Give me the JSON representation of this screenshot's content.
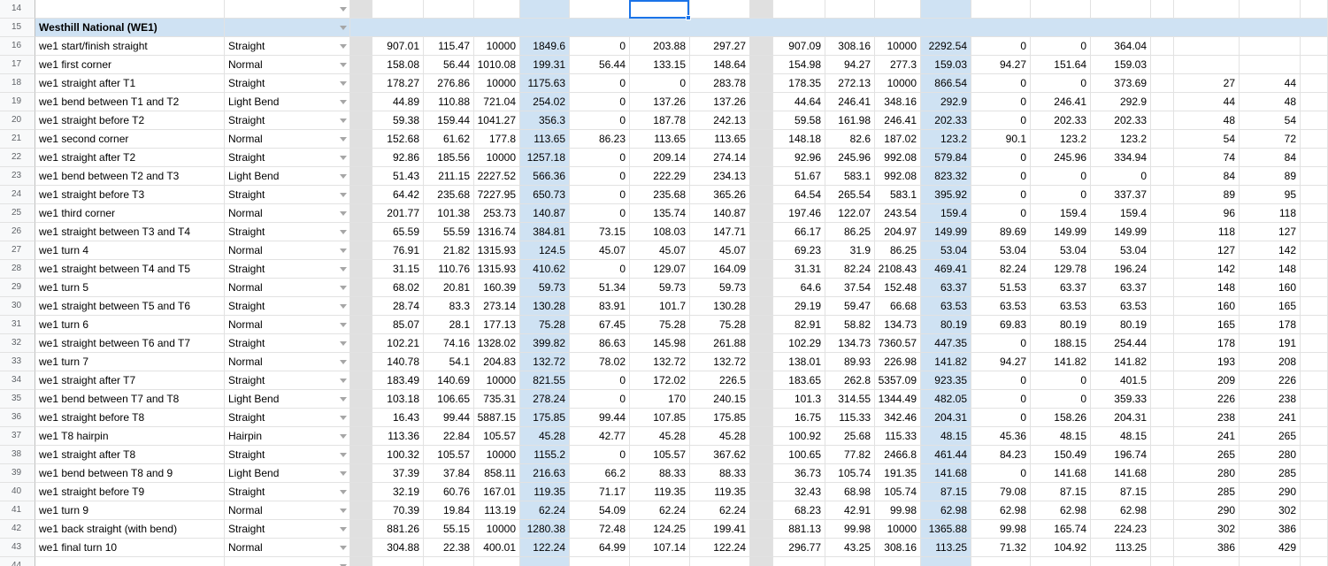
{
  "colors": {
    "selected_column": "#cfe2f3",
    "header_row": "#cfe2f3",
    "separator_column": "#e0e0e0",
    "selection": "#1a73e8"
  },
  "icons": {
    "dropdown": "dropdown-arrow-icon"
  },
  "sheet": {
    "top_row_number": "14",
    "bottom_row_number": "44",
    "header": {
      "row_number": "15",
      "title": "Westhill National (WE1)"
    },
    "rows": [
      {
        "n": "16",
        "name": "we1 start/finish straight",
        "type": "Straight",
        "vals": [
          "907.01",
          "115.47",
          "10000",
          "1849.6",
          "0",
          "203.88",
          "297.27",
          "907.09",
          "308.16",
          "10000",
          "2292.54",
          "0",
          "0",
          "364.04",
          "",
          ""
        ]
      },
      {
        "n": "17",
        "name": "we1 first corner",
        "type": "Normal",
        "vals": [
          "158.08",
          "56.44",
          "1010.08",
          "199.31",
          "56.44",
          "133.15",
          "148.64",
          "154.98",
          "94.27",
          "277.3",
          "159.03",
          "94.27",
          "151.64",
          "159.03",
          "",
          ""
        ]
      },
      {
        "n": "18",
        "name": "we1 straight after T1",
        "type": "Straight",
        "vals": [
          "178.27",
          "276.86",
          "10000",
          "1175.63",
          "0",
          "0",
          "283.78",
          "178.35",
          "272.13",
          "10000",
          "866.54",
          "0",
          "0",
          "373.69",
          "27",
          "44"
        ]
      },
      {
        "n": "19",
        "name": "we1 bend between T1 and T2",
        "type": "Light Bend",
        "vals": [
          "44.89",
          "110.88",
          "721.04",
          "254.02",
          "0",
          "137.26",
          "137.26",
          "44.64",
          "246.41",
          "348.16",
          "292.9",
          "0",
          "246.41",
          "292.9",
          "44",
          "48"
        ]
      },
      {
        "n": "20",
        "name": "we1 straight before T2",
        "type": "Straight",
        "vals": [
          "59.38",
          "159.44",
          "1041.27",
          "356.3",
          "0",
          "187.78",
          "242.13",
          "59.58",
          "161.98",
          "246.41",
          "202.33",
          "0",
          "202.33",
          "202.33",
          "48",
          "54"
        ]
      },
      {
        "n": "21",
        "name": "we1 second corner",
        "type": "Normal",
        "vals": [
          "152.68",
          "61.62",
          "177.8",
          "113.65",
          "86.23",
          "113.65",
          "113.65",
          "148.18",
          "82.6",
          "187.02",
          "123.2",
          "90.1",
          "123.2",
          "123.2",
          "54",
          "72"
        ]
      },
      {
        "n": "22",
        "name": "we1 straight after T2",
        "type": "Straight",
        "vals": [
          "92.86",
          "185.56",
          "10000",
          "1257.18",
          "0",
          "209.14",
          "274.14",
          "92.96",
          "245.96",
          "992.08",
          "579.84",
          "0",
          "245.96",
          "334.94",
          "74",
          "84"
        ]
      },
      {
        "n": "23",
        "name": "we1 bend between T2 and T3",
        "type": "Light Bend",
        "vals": [
          "51.43",
          "211.15",
          "2227.52",
          "566.36",
          "0",
          "222.29",
          "234.13",
          "51.67",
          "583.1",
          "992.08",
          "823.32",
          "0",
          "0",
          "0",
          "84",
          "89"
        ]
      },
      {
        "n": "24",
        "name": "we1 straight before T3",
        "type": "Straight",
        "vals": [
          "64.42",
          "235.68",
          "7227.95",
          "650.73",
          "0",
          "235.68",
          "365.26",
          "64.54",
          "265.54",
          "583.1",
          "395.92",
          "0",
          "0",
          "337.37",
          "89",
          "95"
        ]
      },
      {
        "n": "25",
        "name": "we1 third corner",
        "type": "Normal",
        "vals": [
          "201.77",
          "101.38",
          "253.73",
          "140.87",
          "0",
          "135.74",
          "140.87",
          "197.46",
          "122.07",
          "243.54",
          "159.4",
          "0",
          "159.4",
          "159.4",
          "96",
          "118"
        ]
      },
      {
        "n": "26",
        "name": "we1 straight between T3 and T4",
        "type": "Straight",
        "vals": [
          "65.59",
          "55.59",
          "1316.74",
          "384.81",
          "73.15",
          "108.03",
          "147.71",
          "66.17",
          "86.25",
          "204.97",
          "149.99",
          "89.69",
          "149.99",
          "149.99",
          "118",
          "127"
        ]
      },
      {
        "n": "27",
        "name": "we1 turn 4",
        "type": "Normal",
        "vals": [
          "76.91",
          "21.82",
          "1315.93",
          "124.5",
          "45.07",
          "45.07",
          "45.07",
          "69.23",
          "31.9",
          "86.25",
          "53.04",
          "53.04",
          "53.04",
          "53.04",
          "127",
          "142"
        ]
      },
      {
        "n": "28",
        "name": "we1 straight between T4 and T5",
        "type": "Straight",
        "vals": [
          "31.15",
          "110.76",
          "1315.93",
          "410.62",
          "0",
          "129.07",
          "164.09",
          "31.31",
          "82.24",
          "2108.43",
          "469.41",
          "82.24",
          "129.78",
          "196.24",
          "142",
          "148"
        ]
      },
      {
        "n": "29",
        "name": "we1 turn 5",
        "type": "Normal",
        "vals": [
          "68.02",
          "20.81",
          "160.39",
          "59.73",
          "51.34",
          "59.73",
          "59.73",
          "64.6",
          "37.54",
          "152.48",
          "63.37",
          "51.53",
          "63.37",
          "63.37",
          "148",
          "160"
        ]
      },
      {
        "n": "30",
        "name": "we1 straight between T5 and T6",
        "type": "Straight",
        "vals": [
          "28.74",
          "83.3",
          "273.14",
          "130.28",
          "83.91",
          "101.7",
          "130.28",
          "29.19",
          "59.47",
          "66.68",
          "63.53",
          "63.53",
          "63.53",
          "63.53",
          "160",
          "165"
        ]
      },
      {
        "n": "31",
        "name": "we1 turn 6",
        "type": "Normal",
        "vals": [
          "85.07",
          "28.1",
          "177.13",
          "75.28",
          "67.45",
          "75.28",
          "75.28",
          "82.91",
          "58.82",
          "134.73",
          "80.19",
          "69.83",
          "80.19",
          "80.19",
          "165",
          "178"
        ]
      },
      {
        "n": "32",
        "name": "we1 straight between T6 and T7",
        "type": "Straight",
        "vals": [
          "102.21",
          "74.16",
          "1328.02",
          "399.82",
          "86.63",
          "145.98",
          "261.88",
          "102.29",
          "134.73",
          "7360.57",
          "447.35",
          "0",
          "188.15",
          "254.44",
          "178",
          "191"
        ]
      },
      {
        "n": "33",
        "name": "we1 turn 7",
        "type": "Normal",
        "vals": [
          "140.78",
          "54.1",
          "204.83",
          "132.72",
          "78.02",
          "132.72",
          "132.72",
          "138.01",
          "89.93",
          "226.98",
          "141.82",
          "94.27",
          "141.82",
          "141.82",
          "193",
          "208"
        ]
      },
      {
        "n": "34",
        "name": "we1 straight after T7",
        "type": "Straight",
        "vals": [
          "183.49",
          "140.69",
          "10000",
          "821.55",
          "0",
          "172.02",
          "226.5",
          "183.65",
          "262.8",
          "5357.09",
          "923.35",
          "0",
          "0",
          "401.5",
          "209",
          "226"
        ]
      },
      {
        "n": "35",
        "name": "we1 bend between T7 and T8",
        "type": "Light Bend",
        "vals": [
          "103.18",
          "106.65",
          "735.31",
          "278.24",
          "0",
          "170",
          "240.15",
          "101.3",
          "314.55",
          "1344.49",
          "482.05",
          "0",
          "0",
          "359.33",
          "226",
          "238"
        ]
      },
      {
        "n": "36",
        "name": "we1 straight before T8",
        "type": "Straight",
        "vals": [
          "16.43",
          "99.44",
          "5887.15",
          "175.85",
          "99.44",
          "107.85",
          "175.85",
          "16.75",
          "115.33",
          "342.46",
          "204.31",
          "0",
          "158.26",
          "204.31",
          "238",
          "241"
        ]
      },
      {
        "n": "37",
        "name": "we1 T8 hairpin",
        "type": "Hairpin",
        "vals": [
          "113.36",
          "22.84",
          "105.57",
          "45.28",
          "42.77",
          "45.28",
          "45.28",
          "100.92",
          "25.68",
          "115.33",
          "48.15",
          "45.36",
          "48.15",
          "48.15",
          "241",
          "265"
        ]
      },
      {
        "n": "38",
        "name": "we1 straight after T8",
        "type": "Straight",
        "vals": [
          "100.32",
          "105.57",
          "10000",
          "1155.2",
          "0",
          "105.57",
          "367.62",
          "100.65",
          "77.82",
          "2466.8",
          "461.44",
          "84.23",
          "150.49",
          "196.74",
          "265",
          "280"
        ]
      },
      {
        "n": "39",
        "name": "we1 bend between T8 and 9",
        "type": "Light Bend",
        "vals": [
          "37.39",
          "37.84",
          "858.11",
          "216.63",
          "66.2",
          "88.33",
          "88.33",
          "36.73",
          "105.74",
          "191.35",
          "141.68",
          "0",
          "141.68",
          "141.68",
          "280",
          "285"
        ]
      },
      {
        "n": "40",
        "name": "we1 straight before T9",
        "type": "Straight",
        "vals": [
          "32.19",
          "60.76",
          "167.01",
          "119.35",
          "71.17",
          "119.35",
          "119.35",
          "32.43",
          "68.98",
          "105.74",
          "87.15",
          "79.08",
          "87.15",
          "87.15",
          "285",
          "290"
        ]
      },
      {
        "n": "41",
        "name": "we1 turn 9",
        "type": "Normal",
        "vals": [
          "70.39",
          "19.84",
          "113.19",
          "62.24",
          "54.09",
          "62.24",
          "62.24",
          "68.23",
          "42.91",
          "99.98",
          "62.98",
          "62.98",
          "62.98",
          "62.98",
          "290",
          "302"
        ]
      },
      {
        "n": "42",
        "name": "we1 back straight (with bend)",
        "type": "Straight",
        "vals": [
          "881.26",
          "55.15",
          "10000",
          "1280.38",
          "72.48",
          "124.25",
          "199.41",
          "881.13",
          "99.98",
          "10000",
          "1365.88",
          "99.98",
          "165.74",
          "224.23",
          "302",
          "386"
        ]
      },
      {
        "n": "43",
        "name": "we1 final turn 10",
        "type": "Normal",
        "vals": [
          "304.88",
          "22.38",
          "400.01",
          "122.24",
          "64.99",
          "107.14",
          "122.24",
          "296.77",
          "43.25",
          "308.16",
          "113.25",
          "71.32",
          "104.92",
          "113.25",
          "386",
          "429"
        ]
      }
    ]
  }
}
